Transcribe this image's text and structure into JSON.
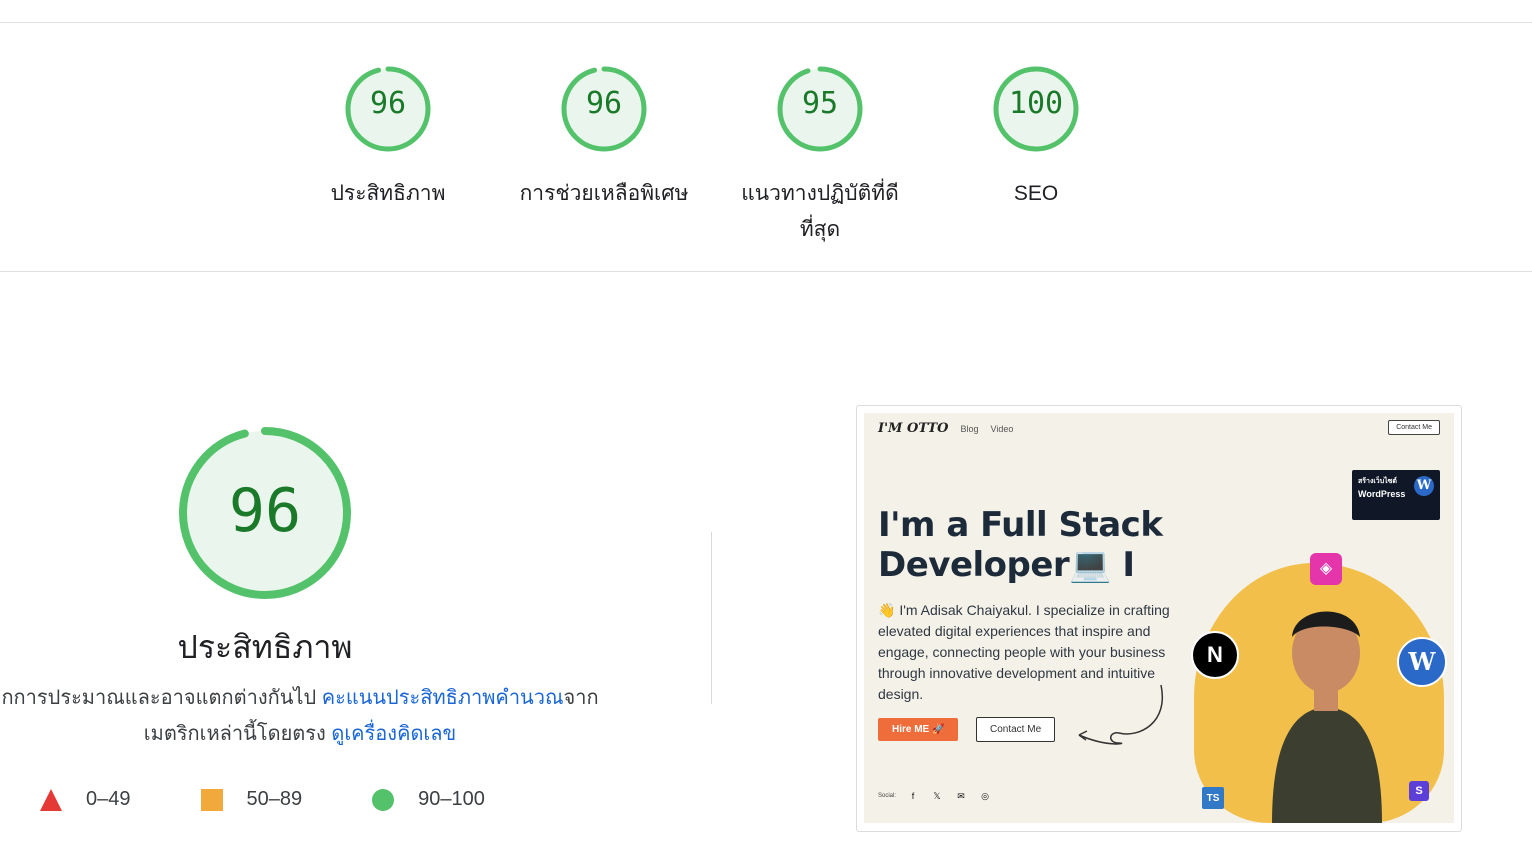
{
  "summary": [
    {
      "score": "96",
      "label": "ประสิทธิภาพ"
    },
    {
      "score": "96",
      "label": "การช่วยเหลือพิเศษ"
    },
    {
      "score": "95",
      "label": "แนวทางปฏิบัติที่ดีที่สุด"
    },
    {
      "score": "100",
      "label": "SEO"
    }
  ],
  "performance": {
    "score": "96",
    "title": "ประสิทธิภาพ",
    "desc_prefix": "กการประมาณและอาจแตกต่างกันไป ",
    "desc_link1": "คะแนนประสิทธิภาพคำนวณ",
    "desc_mid": "จาก",
    "desc_line2": "เมตริกเหล่านี้โดยตรง ",
    "desc_link2": "ดูเครื่องคิดเลข"
  },
  "legend": {
    "fail": "0–49",
    "average": "50–89",
    "pass": "90–100"
  },
  "screenshot": {
    "logo": "I'M OTTO",
    "nav_blog": "Blog",
    "nav_video": "Video",
    "contact_top": "Contact Me",
    "thumb_line1": "สร้างเว็บไซต์",
    "thumb_line2": "WordPress",
    "headline_1": "I'm a Full Stack",
    "headline_2": "Developer💻 I",
    "paragraph": "👋 I'm Adisak Chaiyakul. I specialize in crafting elevated digital experiences that inspire and engage, connecting people with your business through innovative development and intuitive design.",
    "hire_button": "Hire ME 🚀",
    "contact_button": "Contact Me",
    "social_label": "Social:"
  },
  "colors": {
    "pass": "#53c26b",
    "pass_text": "#1b7a2a",
    "link": "#1a66d6"
  }
}
